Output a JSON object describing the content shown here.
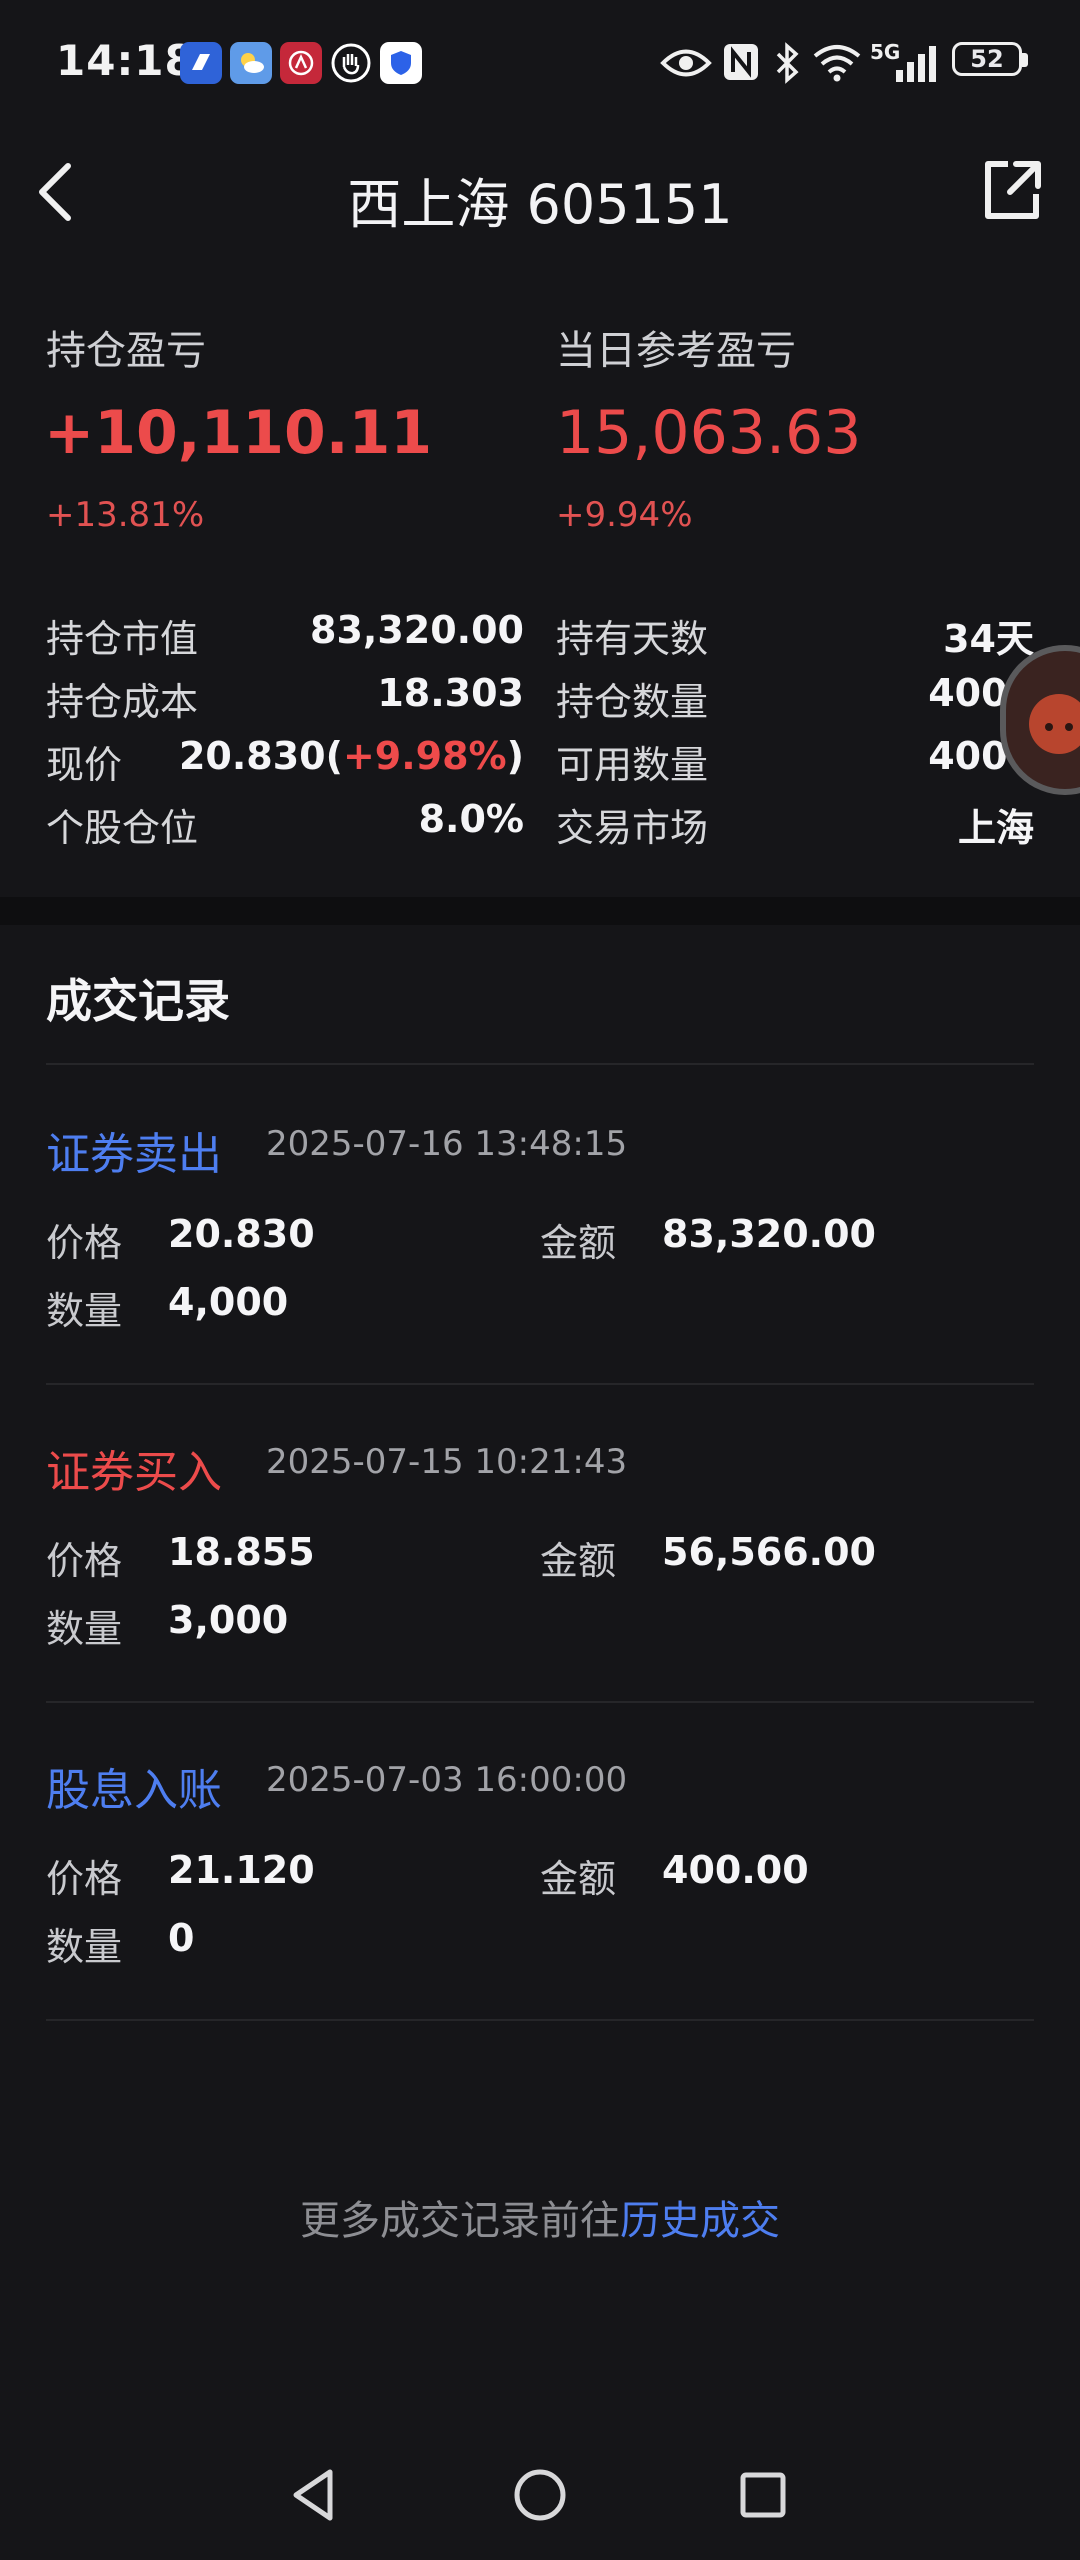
{
  "status_bar": {
    "time": "14:18",
    "network": "5G",
    "battery": "52",
    "app_icons": [
      "app-blue-icon",
      "weather-icon",
      "red-app-icon",
      "hand-icon",
      "shield-icon"
    ]
  },
  "header": {
    "title": "西上海 605151",
    "back_icon": "chevron-left-icon",
    "share_icon": "external-link-icon"
  },
  "summary": {
    "holding_pnl_label": "持仓盈亏",
    "holding_pnl_value": "+10,110.11",
    "holding_pnl_pct": "+13.81%",
    "daily_pnl_label": "当日参考盈亏",
    "daily_pnl_value": "15,063.63",
    "daily_pnl_pct": "+9.94%"
  },
  "details": {
    "left": [
      {
        "label": "持仓市值",
        "value": "83,320.00"
      },
      {
        "label": "持仓成本",
        "value": "18.303"
      },
      {
        "label": "现价",
        "value_main": "20.830(",
        "value_change": "+9.98%",
        "value_close": ")"
      },
      {
        "label": "个股仓位",
        "value": "8.0%"
      }
    ],
    "right": [
      {
        "label": "持有天数",
        "value": "34天"
      },
      {
        "label": "持仓数量",
        "value": "4000"
      },
      {
        "label": "可用数量",
        "value": "4000"
      },
      {
        "label": "交易市场",
        "value": "上海"
      }
    ]
  },
  "records": {
    "title": "成交记录",
    "price_label": "价格",
    "amount_label": "金额",
    "qty_label": "数量",
    "items": [
      {
        "type": "证券卖出",
        "time": "2025-07-16 13:48:15",
        "price": "20.830",
        "amount": "83,320.00",
        "qty": "4,000",
        "type_color": "#4e7ef0"
      },
      {
        "type": "证券买入",
        "time": "2025-07-15 10:21:43",
        "price": "18.855",
        "amount": "56,566.00",
        "qty": "3,000",
        "type_color": "#ec4b4b"
      },
      {
        "type": "股息入账",
        "time": "2025-07-03 16:00:00",
        "price": "21.120",
        "amount": "400.00",
        "qty": "0",
        "type_color": "#4e7ef0"
      }
    ]
  },
  "footer": {
    "text": "更多成交记录前往",
    "link": "历史成交"
  },
  "colors": {
    "background": "#151518",
    "up_red": "#ec4b4b",
    "link_blue": "#4e7ef0"
  }
}
